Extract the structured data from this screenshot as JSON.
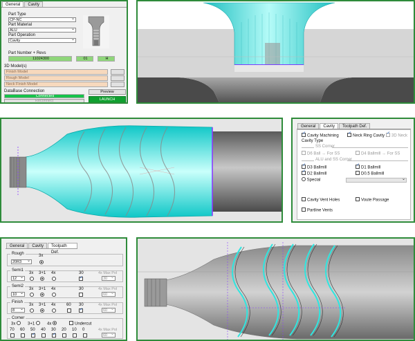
{
  "general_panel": {
    "tabs": [
      "General",
      "Cavity"
    ],
    "part_type_label": "Part Type",
    "part_type_value": "CP-NC",
    "part_material_label": "Part Material",
    "part_material_value": "ALU",
    "part_operation_label": "Part Operation",
    "part_operation_value": "Cavity",
    "part_number_label": "Part Number + Revs",
    "part_number_value": "11024300",
    "rev1": "01",
    "rev2": "H",
    "models_label": "3D Model(s)",
    "finish_model": "Finish Model",
    "rough_model": "Rough Model",
    "neck_finish_model": "Neck Finish Model",
    "db_label": "DataBase Connection",
    "db_status": "Connected",
    "reconnect_button": "Reconnect",
    "preview_button": "Preview",
    "launch_button": "LAUNCH"
  },
  "cavity_panel": {
    "tabs": [
      "General",
      "Cavity",
      "Toolpath Def."
    ],
    "cavity_machining": "Cavity Machining",
    "neck_ring_cavity": "Neck Ring Cavity",
    "neck_3d": "3D Neck",
    "cavity_type_label": "Cavity Type",
    "ss_corner_label": "SS Corner",
    "d6_ball": "D6 Ball",
    "for_ss_1": "For SS",
    "d4_ballmill": "D4 Ballmill",
    "for_ss_2": "For SS",
    "alu_ss_corner_label": "ALU and SS Corner",
    "d3_ballmill": "D3 Ballmill",
    "d1_ballmill": "D1 Ballmill",
    "d2_ballmill": "D2 Ballmill",
    "d05_ballmill": "D0.5 Ballmill",
    "special": "Special",
    "cavity_vent_holes": "Cavity Vent Holes",
    "voute_passage": "Voute Passage",
    "partline_vents": "Partline Vents"
  },
  "toolpath_panel": {
    "tabs": [
      "General",
      "Cavity",
      "Toolpath Def."
    ],
    "rough": {
      "label": "Rough",
      "tool": "20R3",
      "opt": "3x"
    },
    "semi1": {
      "label": "Semi1",
      "tool": "12",
      "opts": [
        "3x",
        "3+1",
        "4x"
      ],
      "num": "30",
      "max_label": "4x Max Pol",
      "max_val": "30"
    },
    "semi2": {
      "label": "Semi2",
      "tool": "10",
      "opts": [
        "3x",
        "3+1",
        "4x"
      ],
      "num": "30",
      "max_label": "4x Max Pol",
      "max_val": "60"
    },
    "finish": {
      "label": "Finish",
      "tool": "8",
      "opts": [
        "3x",
        "3+1",
        "4x"
      ],
      "num1": "60",
      "num2": "30",
      "max_label": "4x Max Pol",
      "max_val": "60"
    },
    "corner": {
      "label": "Corner",
      "opts": [
        "3x",
        "3+1",
        "4x"
      ],
      "undercut": "Undercut",
      "sizes": [
        "70",
        "60",
        "50",
        "40",
        "30",
        "20",
        "10",
        "0"
      ],
      "max_label": "4x Max Pol",
      "max_val": "60"
    }
  },
  "colors": {
    "accent": "#2e8b3a",
    "cyan": "#2fe6e0",
    "green": "#16c24a",
    "peach": "#f7d9bd"
  }
}
